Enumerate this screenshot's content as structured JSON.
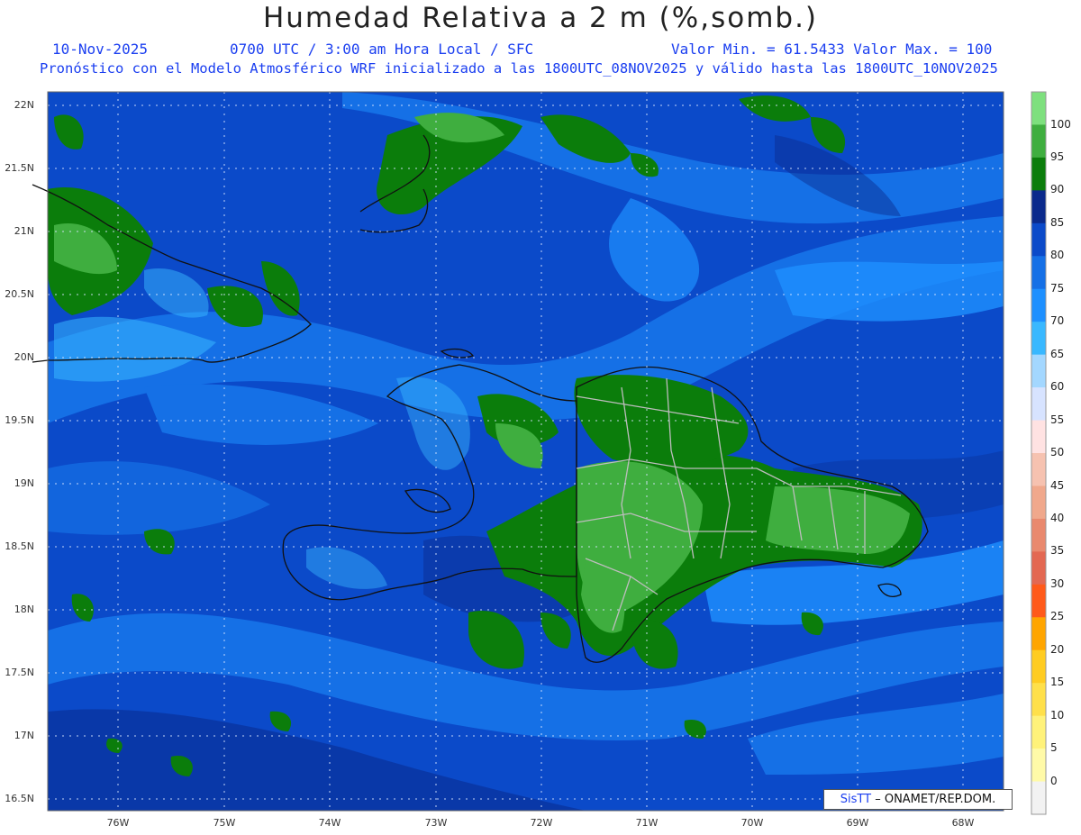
{
  "header": {
    "title": "Humedad Relativa a 2 m (%,somb.)",
    "date": "10-Nov-2025",
    "time": "0700 UTC / 3:00 am Hora Local / SFC",
    "minmax": "Valor Min. = 61.5433  Valor Max. = 100",
    "model_line": "Pronóstico con el Modelo Atmosférico WRF inicializado a las 1800UTC_08NOV2025 y válido hasta las  1800UTC_10NOV2025"
  },
  "axes": {
    "lat_labels": [
      "22N",
      "21.5N",
      "21N",
      "20.5N",
      "20N",
      "19.5N",
      "19N",
      "18.5N",
      "18N",
      "17.5N",
      "17N",
      "16.5N"
    ],
    "lon_labels": [
      "76W",
      "75W",
      "74W",
      "73W",
      "72W",
      "71W",
      "70W",
      "69W",
      "68W"
    ]
  },
  "colorbar": {
    "labels": [
      "100",
      "95",
      "90",
      "85",
      "80",
      "75",
      "70",
      "65",
      "60",
      "55",
      "50",
      "45",
      "40",
      "35",
      "30",
      "25",
      "20",
      "15",
      "10",
      "5",
      "0"
    ],
    "colors": [
      "#7ee07e",
      "#3fae3f",
      "#0b7d0b",
      "#0a2a8c",
      "#0b4ac9",
      "#1570e6",
      "#1e90ff",
      "#39b8ff",
      "#a3d7ff",
      "#d7e3ff",
      "#ffe2e2",
      "#f6c2b0",
      "#f0a88c",
      "#e9896e",
      "#e36852",
      "#ff5a1a",
      "#ffa500",
      "#ffcc22",
      "#ffe04a",
      "#fff27a",
      "#fffaa8",
      "#f2f2f2"
    ]
  },
  "credit": {
    "brand": "SisTT",
    "text": "– ONAMET/REP.DOM."
  }
}
